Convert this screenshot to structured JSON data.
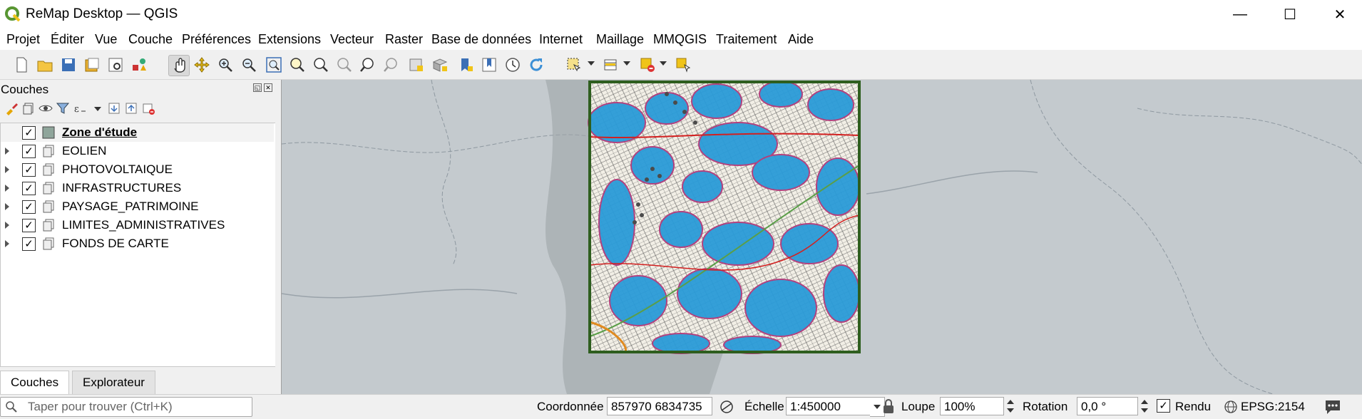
{
  "window": {
    "title": "ReMap Desktop — QGIS",
    "minimize": "—",
    "maximize": "☐",
    "close": "✕"
  },
  "menu": [
    "Projet",
    "Éditer",
    "Vue",
    "Couche",
    "Préférences",
    "Extensions",
    "Vecteur",
    "Raster",
    "Base de données",
    "Internet",
    "Maillage",
    "MMQGIS",
    "Traitement",
    "Aide"
  ],
  "layers_panel": {
    "title": "Couches",
    "layers": [
      {
        "name": "Zone d'étude",
        "checked": "✓",
        "type": "polygon",
        "expandable": false,
        "bold": true
      },
      {
        "name": "EOLIEN",
        "checked": "✓",
        "type": "group",
        "expandable": true
      },
      {
        "name": "PHOTOVOLTAIQUE",
        "checked": "✓",
        "type": "group",
        "expandable": true
      },
      {
        "name": "INFRASTRUCTURES",
        "checked": "✓",
        "type": "group",
        "expandable": true
      },
      {
        "name": "PAYSAGE_PATRIMOINE",
        "checked": "✓",
        "type": "group",
        "expandable": true
      },
      {
        "name": "LIMITES_ADMINISTRATIVES",
        "checked": "✓",
        "type": "group",
        "expandable": true
      },
      {
        "name": "FONDS DE CARTE",
        "checked": "✓",
        "type": "group",
        "expandable": true
      }
    ],
    "tabs": [
      "Couches",
      "Explorateur"
    ]
  },
  "statusbar": {
    "search_placeholder": "Taper pour trouver (Ctrl+K)",
    "coord_label": "Coordonnée",
    "coord_value": "857970 6834735",
    "scale_label": "Échelle",
    "scale_value": "1:450000",
    "magnifier_label": "Loupe",
    "magnifier_value": "100%",
    "rotation_label": "Rotation",
    "rotation_value": "0,0 °",
    "render_label": "Rendu",
    "render_checked": "✓",
    "crs": "EPSG:2154"
  },
  "colors": {
    "accent_green": "#589632",
    "zone_border": "#2e5e1e",
    "buffer_blue": "#1f8fcf",
    "road_red": "#d32020"
  }
}
